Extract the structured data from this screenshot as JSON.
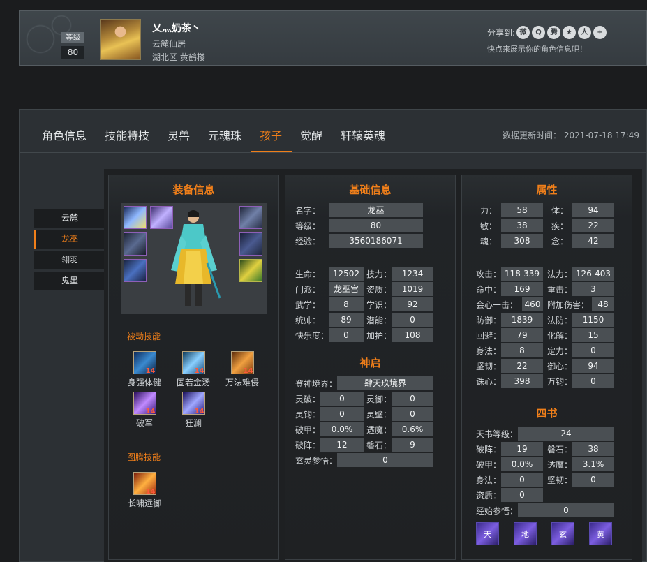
{
  "profile": {
    "level_label": "等级",
    "level_value": "80",
    "name": "乂灬奶茶丶",
    "server": "云麓仙居",
    "region": "湖北区 黄鹤楼",
    "share_label": "分享到:",
    "share_hint": "快点来展示你的角色信息吧！",
    "share_icons": [
      "weibo-icon",
      "qzone-icon",
      "tencent-weibo-icon",
      "favorite-icon",
      "renren-icon",
      "more-icon"
    ]
  },
  "tabs": [
    {
      "label": "角色信息"
    },
    {
      "label": "技能特技"
    },
    {
      "label": "灵兽"
    },
    {
      "label": "元魂珠"
    },
    {
      "label": "孩子"
    },
    {
      "label": "觉醒"
    },
    {
      "label": "轩辕英魂"
    }
  ],
  "active_tab": "孩子",
  "update_time": "数据更新时间： 2021-07-18 17:49",
  "side_menu": [
    {
      "label": "云麓"
    },
    {
      "label": "龙巫"
    },
    {
      "label": "翎羽"
    },
    {
      "label": "鬼墨"
    }
  ],
  "active_side": "龙巫",
  "equipment": {
    "title": "装备信息",
    "passive_title": "被动技能",
    "passive": [
      {
        "name": "身强体健",
        "level": "14"
      },
      {
        "name": "固若金汤",
        "level": "14"
      },
      {
        "name": "万法难侵",
        "level": "14"
      },
      {
        "name": "破军",
        "level": "14"
      },
      {
        "name": "狂澜",
        "level": "14"
      }
    ],
    "totem_title": "图腾技能",
    "totem": [
      {
        "name": "长啸远御",
        "level": "14"
      }
    ]
  },
  "basic": {
    "title": "基础信息",
    "name_label": "名字：",
    "name": "龙巫",
    "level_label": "等级：",
    "level": "80",
    "exp_label": "经验：",
    "exp": "3560186071",
    "hp_label": "生命：",
    "hp": "12502",
    "skill_label": "技力：",
    "skill": "1234",
    "school_label": "门派：",
    "school": "龙巫宫",
    "talent_label": "资质：",
    "talent": "1019",
    "martial_label": "武学：",
    "martial": "8",
    "knowledge_label": "学识：",
    "knowledge": "92",
    "command_label": "统帅：",
    "command": "89",
    "potential_label": "潜能：",
    "potential": "0",
    "happiness_label": "快乐度：",
    "happiness": "0",
    "protect_label": "加护：",
    "protect": "108"
  },
  "shenqi": {
    "title": "神启",
    "realm_label": "登神境界：",
    "realm": "肆天玖境界",
    "lingpo_label": "灵破：",
    "lingpo": "0",
    "lingyu_label": "灵御：",
    "lingyu": "0",
    "lingjun_label": "灵钧：",
    "lingjun": "0",
    "lingbi_label": "灵壁：",
    "lingbi": "0",
    "pojia_label": "破甲：",
    "pojia": "0.0%",
    "toumo_label": "透魔：",
    "toumo": "0.6%",
    "pozhen_label": "破阵：",
    "pozhen": "12",
    "panshi_label": "磐石：",
    "panshi": "9",
    "xuanling_label": "玄灵参悟：",
    "xuanling": "0"
  },
  "attributes": {
    "title": "属性",
    "li_label": "力：",
    "li": "58",
    "ti_label": "体：",
    "ti": "94",
    "min_label": "敏：",
    "min": "38",
    "ji_label": "疾：",
    "ji": "22",
    "hun_label": "魂：",
    "hun": "308",
    "nian_label": "念：",
    "nian": "42",
    "atk_label": "攻击：",
    "atk": "118-339",
    "magic_label": "法力：",
    "magic": "126-403",
    "hit_label": "命中：",
    "hit": "169",
    "heavy_label": "重击：",
    "heavy": "3",
    "crit_label": "会心一击：",
    "crit": "460",
    "extra_label": "附加伤害：",
    "extra": "48",
    "def_label": "防御：",
    "def": "1839",
    "mdef_label": "法防：",
    "mdef": "1150",
    "dodge_label": "回避：",
    "dodge": "79",
    "resolve_label": "化解：",
    "resolve": "15",
    "shenfa_label": "身法：",
    "shenfa": "8",
    "dingli_label": "定力：",
    "dingli": "0",
    "jianren_label": "坚韧：",
    "jianren": "22",
    "yuxin_label": "御心：",
    "yuxin": "94",
    "zhuxin_label": "诛心：",
    "zhuxin": "398",
    "wanjun_label": "万钧：",
    "wanjun": "0"
  },
  "sishu": {
    "title": "四书",
    "tianshu_label": "天书等级：",
    "tianshu": "24",
    "pozhen_label": "破阵：",
    "pozhen": "19",
    "panshi_label": "磐石：",
    "panshi": "38",
    "pojia_label": "破甲：",
    "pojia": "0.0%",
    "toumo_label": "透魔：",
    "toumo": "3.1%",
    "shenfa_label": "身法：",
    "shenfa": "0",
    "jianren_label": "坚韧：",
    "jianren": "0",
    "zizhi_label": "资质：",
    "zizhi": "0",
    "jingshi_label": "经始参悟：",
    "jingshi": "0",
    "books": [
      "天",
      "地",
      "玄",
      "黄"
    ]
  },
  "colors": {
    "accent": "#f07f1a",
    "panel": "#2c3034",
    "value_bg": "#4a4f53"
  }
}
